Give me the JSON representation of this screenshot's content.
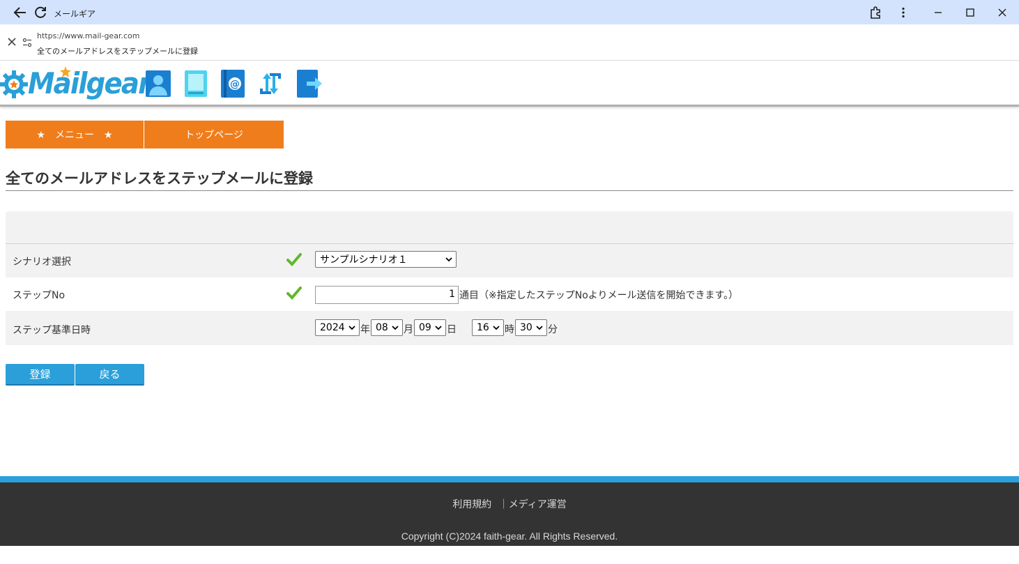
{
  "window": {
    "title": "メールギア",
    "url": "https://www.mail-gear.com",
    "page_title": "全てのメールアドレスをステップメールに登録"
  },
  "header": {
    "logo_text": "Mailgear",
    "icons": [
      "user-icon",
      "book-icon",
      "address-book-icon",
      "sync-icon",
      "logout-icon"
    ]
  },
  "nav": {
    "menu_label": "★　メニュー　★",
    "top_label": "トップページ"
  },
  "page": {
    "heading": "全てのメールアドレスをステップメールに登録"
  },
  "form": {
    "scenario_label": "シナリオ選択",
    "scenario_value": "サンプルシナリオ１",
    "step_no_label": "ステップNo",
    "step_no_value": "1",
    "step_no_suffix": "通目（※指定したステップNoよりメール送信を開始できます。）",
    "base_datetime_label": "ステップ基準日時",
    "year": "2024",
    "year_unit": "年",
    "month": "08",
    "month_unit": "月",
    "day": "09",
    "day_unit": "日",
    "hour": "16",
    "hour_unit": "時",
    "minute": "30",
    "minute_unit": "分"
  },
  "buttons": {
    "register": "登録",
    "back": "戻る"
  },
  "footer": {
    "terms": "利用規約",
    "separator": "｜",
    "media": "メディア運営",
    "copyright": "Copyright (C)2024 faith-gear. All Rights Reserved."
  },
  "colors": {
    "accent_orange": "#f07d1c",
    "accent_blue": "#2b9fd9",
    "footer_bg": "#333333",
    "titlebar_bg": "#d3e3fd"
  }
}
